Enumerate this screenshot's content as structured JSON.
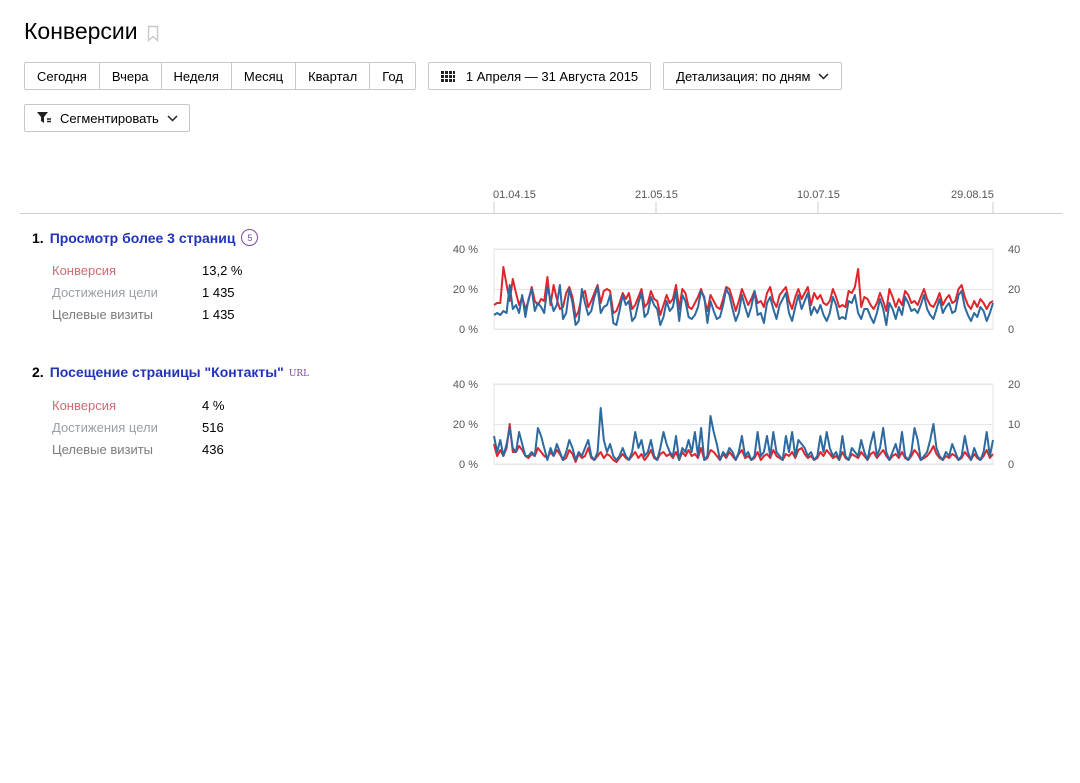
{
  "page": {
    "title": "Конверсии",
    "bookmark_icon": "bookmark-icon"
  },
  "toolbar": {
    "periods": [
      "Сегодня",
      "Вчера",
      "Неделя",
      "Месяц",
      "Квартал",
      "Год"
    ],
    "date_range": "1 Апреля — 31 Августа 2015",
    "date_icon": "calendar-grid-icon",
    "detail_label": "Детализация: по дням",
    "detail_icon": "chevron-down-icon",
    "segment_label": "Сегментировать",
    "segment_icon": "funnel-icon"
  },
  "timeline": {
    "ticks": [
      {
        "label": "01.04.15",
        "color": "#666666"
      },
      {
        "label": "21.05.15",
        "color": "#666666"
      },
      {
        "label": "10.07.15",
        "color": "#666666"
      },
      {
        "label": "29.08.15",
        "color": "#b02424"
      }
    ]
  },
  "colors": {
    "conversion_line": "#e0252c",
    "visits_line": "#2d6a9f",
    "title_link": "#2233bb",
    "grid": "#e6e6e6"
  },
  "goals": [
    {
      "number": "1.",
      "title": "Просмотр более 3 страниц",
      "badge": "5",
      "url_tag": "",
      "metrics": [
        {
          "label": "Конверсия",
          "value": "13,2 %"
        },
        {
          "label": "Достижения цели",
          "value": "1 435"
        },
        {
          "label": "Целевые визиты",
          "value": "1 435"
        }
      ],
      "chart_data": {
        "type": "line",
        "y_left_ticks": [
          "40 %",
          "20 %",
          "0 %"
        ],
        "y_right_ticks": [
          "40",
          "20",
          "0"
        ],
        "ylim_left": [
          0,
          40
        ],
        "ylim_right": [
          0,
          40
        ],
        "series": [
          {
            "values": [
              12,
              13,
              13,
              31,
              22,
              14,
              25,
              18,
              12,
              16,
              10,
              14,
              21,
              14,
              12,
              15,
              14,
              26,
              12,
              22,
              15,
              10,
              11,
              18,
              21,
              16,
              6,
              9,
              17,
              19,
              11,
              14,
              18,
              22,
              13,
              19,
              20,
              19,
              8,
              9,
              13,
              18,
              15,
              18,
              10,
              12,
              16,
              20,
              11,
              13,
              19,
              15,
              14,
              7,
              12,
              17,
              13,
              15,
              22,
              10,
              20,
              18,
              11,
              10,
              13,
              16,
              20,
              15,
              9,
              17,
              14,
              11,
              10,
              15,
              21,
              20,
              15,
              9,
              14,
              20,
              16,
              12,
              15,
              19,
              13,
              14,
              11,
              18,
              21,
              14,
              11,
              17,
              19,
              21,
              14,
              10,
              16,
              20,
              15,
              18,
              21,
              12,
              18,
              15,
              17,
              13,
              12,
              14,
              20,
              16,
              11,
              12,
              11,
              19,
              18,
              21,
              30,
              11,
              16,
              15,
              12,
              10,
              13,
              18,
              14,
              9,
              20,
              16,
              11,
              15,
              12,
              19,
              17,
              13,
              14,
              12,
              16,
              20,
              15,
              12,
              11,
              14,
              18,
              12,
              15,
              17,
              13,
              14,
              20,
              22,
              16,
              12,
              10,
              14,
              11,
              15,
              13,
              10,
              13,
              14
            ]
          },
          {
            "values": [
              7,
              8,
              7,
              9,
              8,
              22,
              10,
              12,
              8,
              17,
              6,
              15,
              20,
              9,
              13,
              11,
              8,
              21,
              15,
              9,
              12,
              22,
              5,
              8,
              20,
              13,
              2,
              4,
              20,
              13,
              7,
              9,
              16,
              21,
              8,
              11,
              12,
              17,
              3,
              2,
              9,
              17,
              12,
              14,
              4,
              6,
              13,
              18,
              6,
              8,
              16,
              12,
              10,
              2,
              6,
              14,
              9,
              11,
              19,
              4,
              17,
              14,
              6,
              5,
              7,
              11,
              19,
              16,
              3,
              14,
              9,
              5,
              6,
              12,
              20,
              17,
              10,
              4,
              8,
              17,
              11,
              6,
              11,
              19,
              7,
              8,
              3,
              13,
              16,
              10,
              5,
              12,
              15,
              18,
              8,
              4,
              11,
              17,
              10,
              14,
              18,
              7,
              11,
              8,
              12,
              7,
              4,
              8,
              16,
              12,
              5,
              6,
              5,
              14,
              13,
              17,
              8,
              5,
              10,
              10,
              6,
              3,
              8,
              15,
              10,
              2,
              13,
              10,
              5,
              11,
              7,
              16,
              13,
              9,
              10,
              8,
              12,
              17,
              10,
              7,
              5,
              10,
              15,
              8,
              11,
              13,
              8,
              9,
              17,
              19,
              11,
              7,
              4,
              8,
              6,
              11,
              9,
              4,
              8,
              13
            ]
          }
        ]
      }
    },
    {
      "number": "2.",
      "title": "Посещение страницы \"Контакты\"",
      "badge": "",
      "url_tag": "URL",
      "metrics": [
        {
          "label": "Конверсия",
          "value": "4 %"
        },
        {
          "label": "Достижения цели",
          "value": "516"
        },
        {
          "label": "Целевые визиты",
          "value": "436"
        }
      ],
      "chart_data": {
        "type": "line",
        "y_left_ticks": [
          "40 %",
          "20 %",
          "0 %"
        ],
        "y_right_ticks": [
          "20",
          "10",
          "0"
        ],
        "ylim_left": [
          0,
          40
        ],
        "ylim_right": [
          0,
          20
        ],
        "series": [
          {
            "values": [
              10,
              4,
              7,
              4,
              8,
              20,
              6,
              6,
              9,
              7,
              4,
              3,
              5,
              4,
              8,
              6,
              4,
              3,
              6,
              4,
              7,
              5,
              2,
              3,
              7,
              5,
              1,
              5,
              3,
              4,
              8,
              3,
              2,
              4,
              6,
              3,
              5,
              4,
              2,
              1,
              3,
              5,
              3,
              2,
              4,
              6,
              3,
              5,
              2,
              4,
              7,
              3,
              2,
              5,
              6,
              4,
              5,
              3,
              6,
              2,
              6,
              4,
              7,
              4,
              5,
              3,
              8,
              2,
              3,
              7,
              6,
              4,
              2,
              5,
              3,
              6,
              4,
              2,
              5,
              7,
              3,
              4,
              2,
              3,
              6,
              2,
              4,
              5,
              3,
              7,
              4,
              3,
              2,
              5,
              4,
              6,
              3,
              7,
              8,
              5,
              3,
              4,
              2,
              3,
              6,
              4,
              7,
              5,
              3,
              4,
              2,
              6,
              3,
              2,
              5,
              4,
              3,
              6,
              4,
              2,
              5,
              6,
              3,
              5,
              7,
              4,
              2,
              4,
              5,
              3,
              6,
              3,
              2,
              4,
              7,
              5,
              2,
              3,
              4,
              6,
              9,
              5,
              3,
              2,
              4,
              3,
              5,
              4,
              2,
              3,
              6,
              4,
              2,
              5,
              3,
              2,
              4,
              7,
              3,
              5
            ]
          },
          {
            "values": [
              7,
              3,
              6,
              2,
              5,
              9,
              4,
              3,
              8,
              5,
              2,
              2,
              3,
              2,
              9,
              7,
              4,
              1,
              4,
              2,
              5,
              3,
              1,
              3,
              6,
              4,
              1,
              3,
              2,
              4,
              6,
              2,
              1,
              3,
              14,
              6,
              3,
              5,
              2,
              1,
              2,
              4,
              2,
              1,
              3,
              8,
              4,
              6,
              2,
              3,
              6,
              2,
              1,
              4,
              8,
              5,
              3,
              2,
              7,
              1,
              4,
              3,
              6,
              3,
              8,
              2,
              9,
              1,
              2,
              12,
              8,
              5,
              1,
              3,
              2,
              4,
              3,
              1,
              3,
              7,
              2,
              3,
              1,
              2,
              8,
              2,
              3,
              7,
              2,
              8,
              3,
              2,
              1,
              7,
              3,
              8,
              2,
              6,
              5,
              4,
              2,
              3,
              1,
              2,
              7,
              3,
              8,
              4,
              2,
              3,
              1,
              7,
              2,
              1,
              4,
              3,
              2,
              6,
              3,
              1,
              5,
              8,
              2,
              4,
              9,
              3,
              1,
              3,
              5,
              2,
              8,
              2,
              1,
              3,
              9,
              6,
              1,
              2,
              3,
              6,
              10,
              4,
              2,
              1,
              3,
              2,
              5,
              3,
              1,
              2,
              7,
              3,
              1,
              4,
              2,
              1,
              3,
              8,
              2,
              6
            ]
          }
        ]
      }
    }
  ]
}
